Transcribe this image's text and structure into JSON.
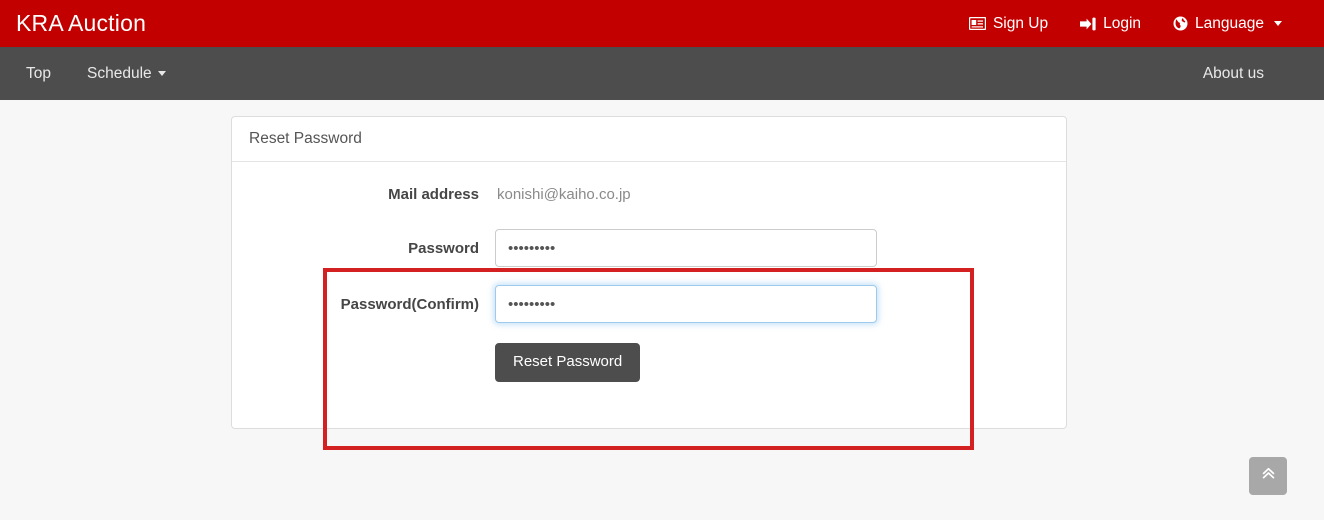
{
  "header": {
    "brand": "KRA Auction",
    "nav": [
      {
        "label": "Sign Up",
        "icon": "id-card-icon",
        "caret": false
      },
      {
        "label": "Login",
        "icon": "sign-in-icon",
        "caret": false
      },
      {
        "label": "Language",
        "icon": "globe-icon",
        "caret": true
      }
    ]
  },
  "navbar": {
    "left": [
      {
        "label": "Top",
        "caret": false
      },
      {
        "label": "Schedule",
        "caret": true
      }
    ],
    "right": {
      "label": "About us"
    }
  },
  "panel": {
    "heading": "Reset Password",
    "mail_label": "Mail address",
    "mail_value": "konishi@kaiho.co.jp",
    "password_label": "Password",
    "password_value": "•••••••••",
    "password_placeholder": "",
    "confirm_label": "Password(Confirm)",
    "confirm_value": "•••••••••",
    "confirm_placeholder": "",
    "submit_label": "Reset Password"
  },
  "scroll_top": {
    "icon": "chevron-double-up-icon"
  },
  "colors": {
    "brand_red": "#c30000",
    "nav_gray": "#4d4d4d",
    "highlight_red": "#d32020",
    "focus_blue": "#66afe9",
    "page_bg": "#f7f7f7"
  }
}
